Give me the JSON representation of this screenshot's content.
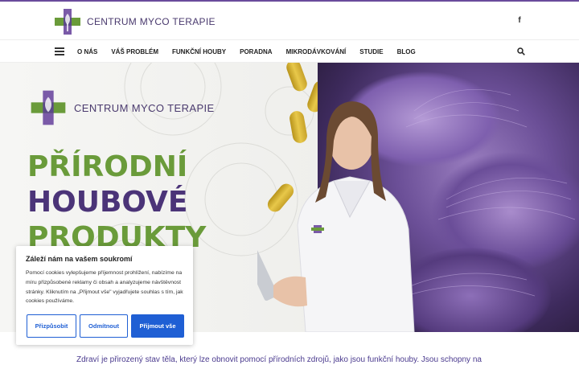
{
  "header": {
    "brand": "CENTRUM MYCO TERAPIE",
    "facebook_icon": "facebook-icon",
    "facebook_glyph": "f"
  },
  "nav": {
    "menu_icon": "hamburger-menu-icon",
    "items": [
      "O NÁS",
      "VÁŠ PROBLÉM",
      "FUNKČNÍ HOUBY",
      "PORADNA",
      "MIKRODÁVKOVÁNÍ",
      "STUDIE",
      "BLOG"
    ],
    "search_icon": "search-icon"
  },
  "hero": {
    "brand": "CENTRUM MYCO TERAPIE",
    "title_lines": [
      "PŘÍRODNÍ",
      "HOUBOVÉ",
      "PRODUKTY"
    ]
  },
  "cookie": {
    "title": "Záleží nám na vašem soukromí",
    "text": "Pomocí cookies vylepšujeme příjemnost prohlížení, nabízíme na míru přizpůsobené reklamy či obsah a analyzujeme návštěvnost stránky. Kliknutím na „Přijmout vše\" vyjadřujete souhlas s tím, jak cookies používáme.",
    "buttons": {
      "customize": "Přizpůsobit",
      "reject": "Odmítnout",
      "accept": "Přijmout vše"
    }
  },
  "intro": {
    "text": "Zdraví je přirozený stav těla, který lze obnovit pomocí přírodních zdrojů, jako jsou funkční houby. Jsou schopny na"
  },
  "colors": {
    "brand_purple": "#4b3478",
    "brand_green": "#6a9b3a",
    "accent_blue": "#1f5fd4"
  }
}
